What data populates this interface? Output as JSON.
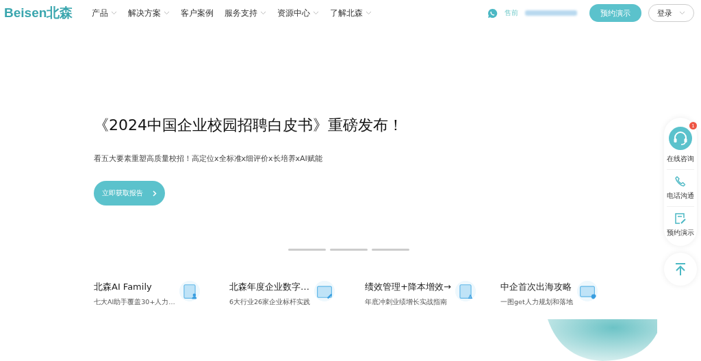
{
  "header": {
    "logo": "Beisen北森",
    "nav": [
      {
        "label": "产品",
        "has_menu": true
      },
      {
        "label": "解决方案",
        "has_menu": true
      },
      {
        "label": "客户案例",
        "has_menu": false
      },
      {
        "label": "服务支持",
        "has_menu": true
      },
      {
        "label": "资源中心",
        "has_menu": true
      },
      {
        "label": "了解北森",
        "has_menu": true
      }
    ],
    "phone_label": "售前",
    "demo_button": "预约演示",
    "login_button": "登录"
  },
  "hero": {
    "title": "《2024中国企业校园招聘白皮书》重磅发布！",
    "subtitle": "看五大要素重塑高质量校招！高定位x全标准x细评价x长培养xAI赋能",
    "cta": "立即获取报告"
  },
  "cards": [
    {
      "title": "北森AI Family",
      "subtitle": "七大AI助手覆盖30+人力…",
      "kind": "person"
    },
    {
      "title": "北森年度企业数字…",
      "subtitle": "6大行业26家企业标杆实践",
      "kind": "pen"
    },
    {
      "title": "绩效管理+降本增效→",
      "subtitle": "年底冲刺业绩增长实战指南",
      "kind": "chart"
    },
    {
      "title": "中企首次出海攻略",
      "subtitle": "一图get人力规划和落地",
      "kind": "globe"
    }
  ],
  "sidebar": [
    {
      "label": "在线咨询",
      "kind": "chat",
      "badge": "1"
    },
    {
      "label": "电话沟通",
      "kind": "phone"
    },
    {
      "label": "预约演示",
      "kind": "demo"
    }
  ]
}
